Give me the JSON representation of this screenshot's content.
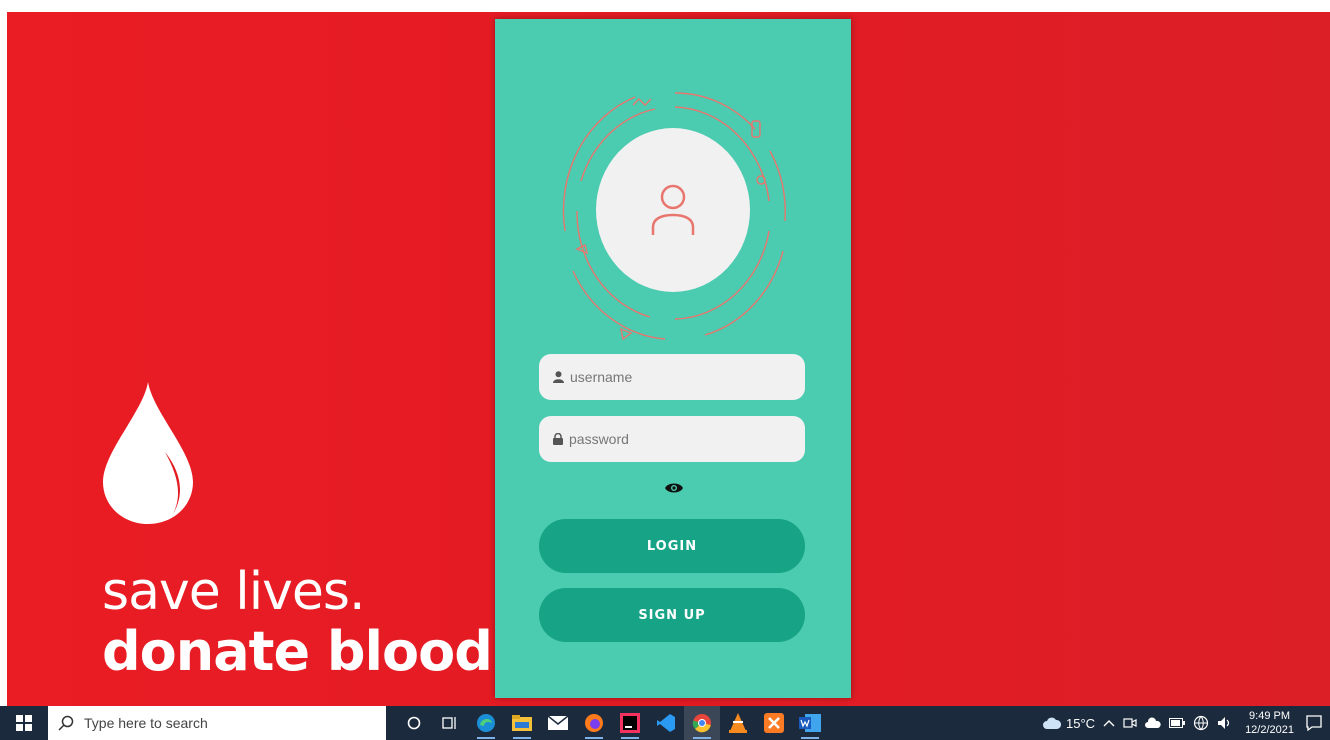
{
  "background": {
    "tagline_line1": "save lives.",
    "tagline_line2": "donate blood.",
    "color": "#e31b23"
  },
  "login_card": {
    "color": "#4bcbb0",
    "avatar_icon": "user-icon",
    "username": {
      "placeholder": "username",
      "value": "",
      "icon": "user-icon"
    },
    "password": {
      "placeholder": "password",
      "value": "",
      "icon": "lock-icon"
    },
    "show_password_icon": "eye-icon",
    "login_label": "LOGIN",
    "signup_label": "SIGN UP",
    "button_color": "#17a385"
  },
  "taskbar": {
    "search_placeholder": "Type here to search",
    "apps": [
      "cortana-icon",
      "task-view-icon",
      "edge-icon",
      "file-explorer-icon",
      "mail-icon",
      "firefox-icon",
      "intellij-icon",
      "vscode-icon",
      "chrome-icon",
      "vlc-icon",
      "xampp-icon",
      "word-icon"
    ],
    "weather": "15°C",
    "time": "9:49 PM",
    "date": "12/2/2021"
  }
}
